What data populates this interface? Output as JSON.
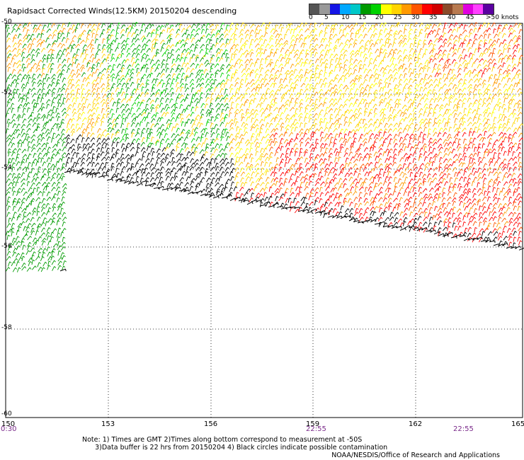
{
  "title": "Rapidsact Corrected Winds(12.5KM) 20150204 descending",
  "legend": {
    "colors": [
      "#555555",
      "#999999",
      "#1515e6",
      "#00a8ff",
      "#00c8c8",
      "#009a00",
      "#00d200",
      "#ffff00",
      "#ffd400",
      "#ff9a00",
      "#ff5500",
      "#ff0000",
      "#d00000",
      "#8b4a2a",
      "#b87a50",
      "#e000e0",
      "#ff40ff",
      "#5a00a0"
    ],
    "labels": [
      "0",
      "5",
      "10",
      "15",
      "20",
      "25",
      "30",
      "35",
      "40",
      "45",
      ">50 knots"
    ]
  },
  "axes": {
    "lat_labels": [
      "-50",
      "-52",
      "-54",
      "-56",
      "-58",
      "-60"
    ],
    "lon_labels": [
      "150",
      "153",
      "156",
      "159",
      "162",
      "165"
    ]
  },
  "time_labels": [
    "0:30",
    "22:55",
    "22:55"
  ],
  "notes": {
    "line1": "Note: 1) Times are GMT 2)Times along bottom correspond to measurement at -50S",
    "line2": "      3)Data buffer is 22 hrs from 20150204 4) Black circles indicate possible contamination"
  },
  "credit": "NOAA/NESDIS/Office of Research and Applications"
}
